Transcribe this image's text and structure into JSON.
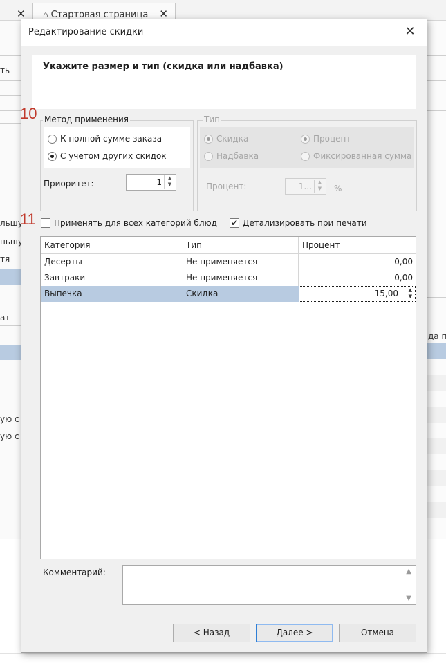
{
  "background": {
    "tab_title": "Стартовая страница",
    "left_fragments": [
      "ть",
      "льшу",
      "ньшу",
      "тя",
      "ат",
      "ую с",
      "ую с"
    ],
    "right_fragments": [
      "да пе"
    ]
  },
  "dialog": {
    "title": "Редактирование скидки",
    "header": "Укажите размер и тип (скидка или надбавка)",
    "annotations": [
      "10",
      "11"
    ],
    "method": {
      "legend": "Метод применения",
      "options": [
        "К полной сумме заказа",
        "С учетом других скидок"
      ],
      "selected_index": 1,
      "priority_label": "Приоритет:",
      "priority_value": "1"
    },
    "type_group": {
      "legend": "Тип",
      "options": [
        "Скидка",
        "Надбавка"
      ],
      "selected_index": 0,
      "value_options": [
        "Процент",
        "Фиксированная сумма"
      ],
      "value_selected_index": 0,
      "percent_label": "Процент:",
      "percent_value": "1...",
      "percent_unit": "%"
    },
    "apply_all_label": "Применять для всех категорий блюд",
    "apply_all_checked": false,
    "detail_label": "Детализировать при печати",
    "detail_checked": true,
    "table": {
      "columns": [
        "Категория",
        "Тип",
        "Процент"
      ],
      "rows": [
        {
          "category": "Десерты",
          "type": "Не применяется",
          "percent": "0,00"
        },
        {
          "category": "Завтраки",
          "type": "Не применяется",
          "percent": "0,00"
        },
        {
          "category": "Выпечка",
          "type": "Скидка",
          "percent": "15,00"
        }
      ],
      "selected_row": 2
    },
    "comment_label": "Комментарий:",
    "comment_value": "",
    "buttons": {
      "back": "< Назад",
      "next": "Далее >",
      "cancel": "Отмена"
    }
  },
  "colors": {
    "selection": "#b8cbe1",
    "annotation": "#c0392b",
    "primary_button_border": "#2f7fd6",
    "dialog_bg": "#f0f0f0"
  }
}
